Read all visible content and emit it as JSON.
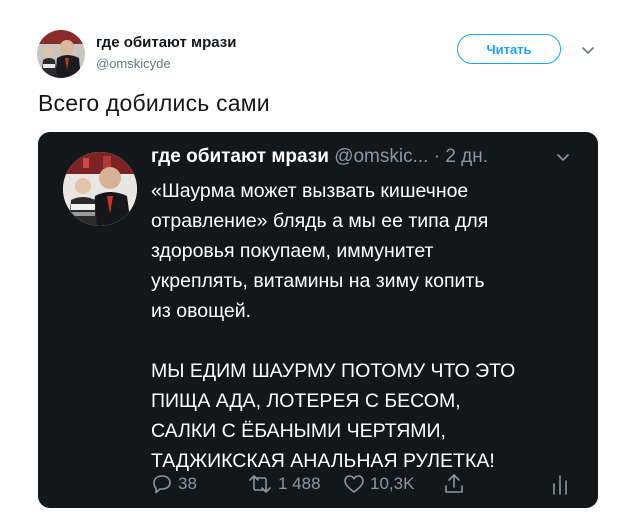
{
  "tweet": {
    "author_name": "где обитают мрази",
    "author_handle": "@omskicyde",
    "follow_label": "Читать",
    "text": "Всего добились сами"
  },
  "quote": {
    "author_name": "где обитают мрази",
    "author_handle": "@omskic...",
    "date": "· 2 дн.",
    "paragraphs": [
      "«Шаурма может вызвать кишечное\nотравление» блядь а мы ее типа для\nздоровья покупаем, иммунитет\nукреплять, витамины на зиму копить\nиз овощей.",
      "МЫ ЕДИМ ШАУРМУ ПОТОМУ ЧТО ЭТО\nПИЩА АДА, ЛОТЕРЕЯ С БЕСОМ,\nСАЛКИ С ЁБАНЫМИ ЧЕРТЯМИ,\nТАДЖИКСКАЯ АНАЛЬНАЯ РУЛЕТКА!"
    ],
    "actions": {
      "replies": "38",
      "retweets": "1 488",
      "likes": "10,3K"
    }
  },
  "icons": {
    "caret": "chevron-down-icon",
    "reply": "reply-icon",
    "retweet": "retweet-icon",
    "like": "heart-icon",
    "share": "share-icon",
    "analytics": "analytics-icon"
  },
  "colors": {
    "accent": "#1da1f2",
    "card_bg": "#14171a",
    "muted": "#8899a6"
  }
}
